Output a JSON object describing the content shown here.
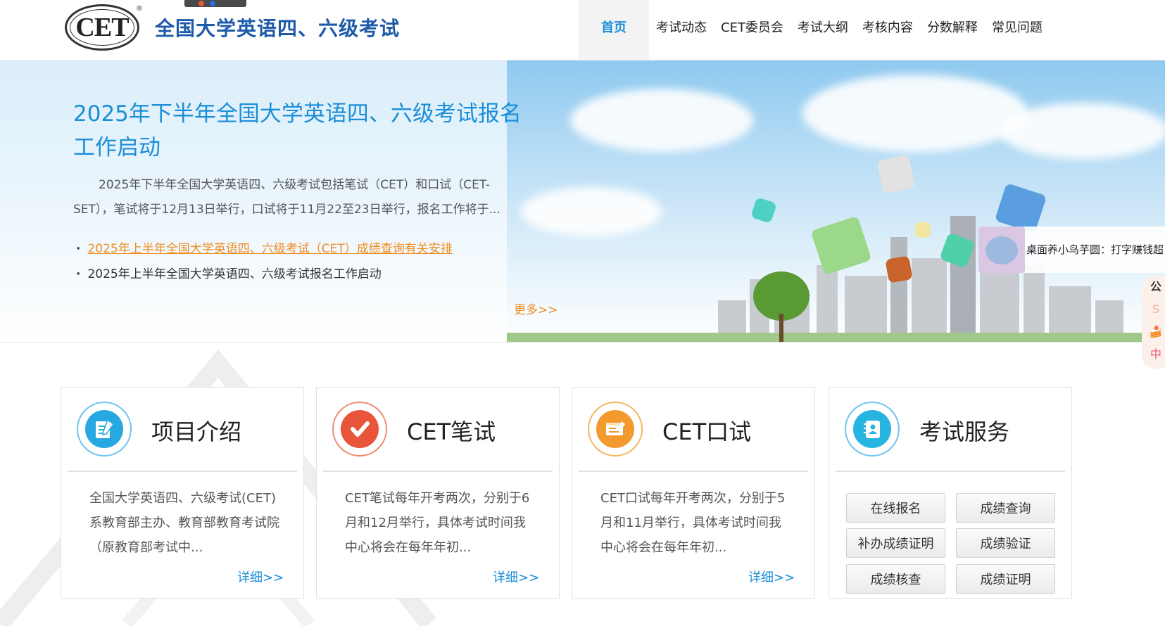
{
  "header": {
    "logo_text": "CET",
    "logo_reg": "®",
    "site_title": "全国大学英语四、六级考试"
  },
  "nav": [
    {
      "label": "首页",
      "active": true
    },
    {
      "label": "考试动态"
    },
    {
      "label": "CET委员会"
    },
    {
      "label": "考试大纲"
    },
    {
      "label": "考核内容"
    },
    {
      "label": "分数解释"
    },
    {
      "label": "常见问题"
    }
  ],
  "banner": {
    "title": "2025年下半年全国大学英语四、六级考试报名工作启动",
    "summary": "2025年下半年全国大学英语四、六级考试包括笔试（CET）和口试（CET-SET），笔试将于12月13日举行，口试将于11月22至23日举行，报名工作将于...",
    "links": [
      {
        "text": "2025年上半年全国大学英语四、六级考试（CET）成绩查询有关安排"
      },
      {
        "text": "2025年上半年全国大学英语四、六级考试报名工作启动"
      }
    ],
    "more": "更多>>"
  },
  "popup": {
    "text": "桌面养小鸟芋圆：打字赚钱超",
    "side_chars": [
      "公",
      "S",
      "🍰",
      "中"
    ]
  },
  "cards": [
    {
      "title": "项目介绍",
      "text": "全国大学英语四、六级考试(CET)系教育部主办、教育部教育考试院（原教育部考试中...",
      "more": "详细>>",
      "icon": "document-pen-icon"
    },
    {
      "title": "CET笔试",
      "text": "CET笔试每年开考两次，分别于6月和12月举行，具体考试时间我中心将会在每年年初...",
      "more": "详细>>",
      "icon": "checkmark-icon"
    },
    {
      "title": "CET口试",
      "text": "CET口试每年开考两次，分别于5月和11月举行，具体考试时间我中心将会在每年年初...",
      "more": "详细>>",
      "icon": "form-edit-icon"
    },
    {
      "title": "考试服务",
      "icon": "contact-book-icon",
      "buttons": [
        "在线报名",
        "成绩查询",
        "补办成绩证明",
        "成绩验证",
        "成绩核查",
        "成绩证明"
      ]
    }
  ],
  "colors": {
    "accent": "#1a8ed8",
    "orange": "#f08c1f",
    "title_blue": "#1d5ba8",
    "check_red": "#e8553a",
    "form_orange": "#f29a2e",
    "book_blue": "#27a8e0"
  }
}
